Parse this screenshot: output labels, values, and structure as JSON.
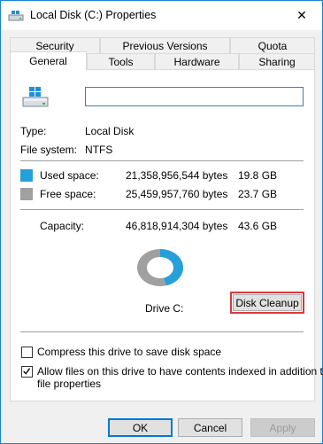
{
  "window": {
    "title": "Local Disk (C:) Properties",
    "close_glyph": "✕"
  },
  "tabs": {
    "back": [
      "Security",
      "Previous Versions",
      "Quota"
    ],
    "front": [
      "General",
      "Tools",
      "Hardware",
      "Sharing"
    ],
    "active": "General"
  },
  "general": {
    "name_value": "",
    "type_label": "Type:",
    "type_value": "Local Disk",
    "fs_label": "File system:",
    "fs_value": "NTFS",
    "used_label": "Used space:",
    "used_bytes": "21,358,956,544 bytes",
    "used_gb": "19.8 GB",
    "free_label": "Free space:",
    "free_bytes": "25,459,957,760 bytes",
    "free_gb": "23.7 GB",
    "capacity_label": "Capacity:",
    "capacity_bytes": "46,818,914,304 bytes",
    "capacity_gb": "43.6 GB",
    "drive_label": "Drive C:",
    "cleanup_label": "Disk Cleanup",
    "used_fraction": 0.456,
    "colors": {
      "used": "#26a0da",
      "free": "#a0a0a0"
    }
  },
  "options": {
    "compress_label": "Compress this drive to save disk space",
    "compress_checked": false,
    "index_label_line1": "Allow files on this drive to have contents indexed in addition to",
    "index_label_line2": "file properties",
    "index_checked": true
  },
  "buttons": {
    "ok": "OK",
    "cancel": "Cancel",
    "apply": "Apply"
  }
}
